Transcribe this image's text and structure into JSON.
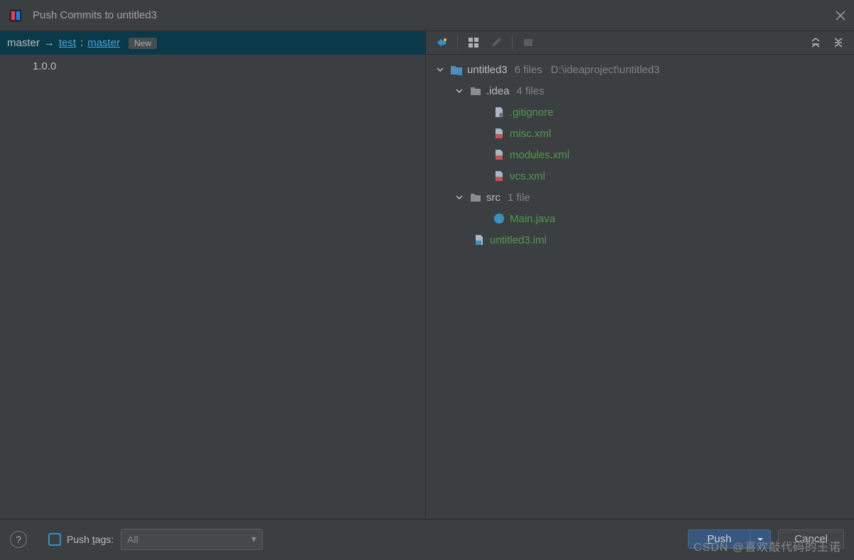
{
  "window": {
    "title": "Push Commits to untitled3"
  },
  "branch": {
    "from": "master",
    "remote": "test",
    "to": "master",
    "sep": ":",
    "badge": "New"
  },
  "commits": [
    {
      "label": "1.0.0"
    }
  ],
  "tree": {
    "root": {
      "name": "untitled3",
      "meta": "6 files",
      "path": "D:\\ideaproject\\untitled3"
    },
    "children": [
      {
        "name": ".idea",
        "type": "folder",
        "meta": "4 files",
        "children": [
          {
            "name": ".gitignore",
            "type": "file-text"
          },
          {
            "name": "misc.xml",
            "type": "file-xml"
          },
          {
            "name": "modules.xml",
            "type": "file-xml"
          },
          {
            "name": "vcs.xml",
            "type": "file-xml"
          }
        ]
      },
      {
        "name": "src",
        "type": "folder",
        "meta": "1 file",
        "children": [
          {
            "name": "Main.java",
            "type": "file-java"
          }
        ]
      },
      {
        "name": "untitled3.iml",
        "type": "file-iml"
      }
    ]
  },
  "footer": {
    "push_tags_label_pre": "Push ",
    "push_tags_label_ul": "t",
    "push_tags_label_post": "ags:",
    "push_tags_value": "All",
    "push_label_pre": "",
    "push_label_ul": "P",
    "push_label_post": "ush",
    "cancel_label": "Cancel"
  },
  "watermark": "CSDN @喜欢敲代码的王诺"
}
